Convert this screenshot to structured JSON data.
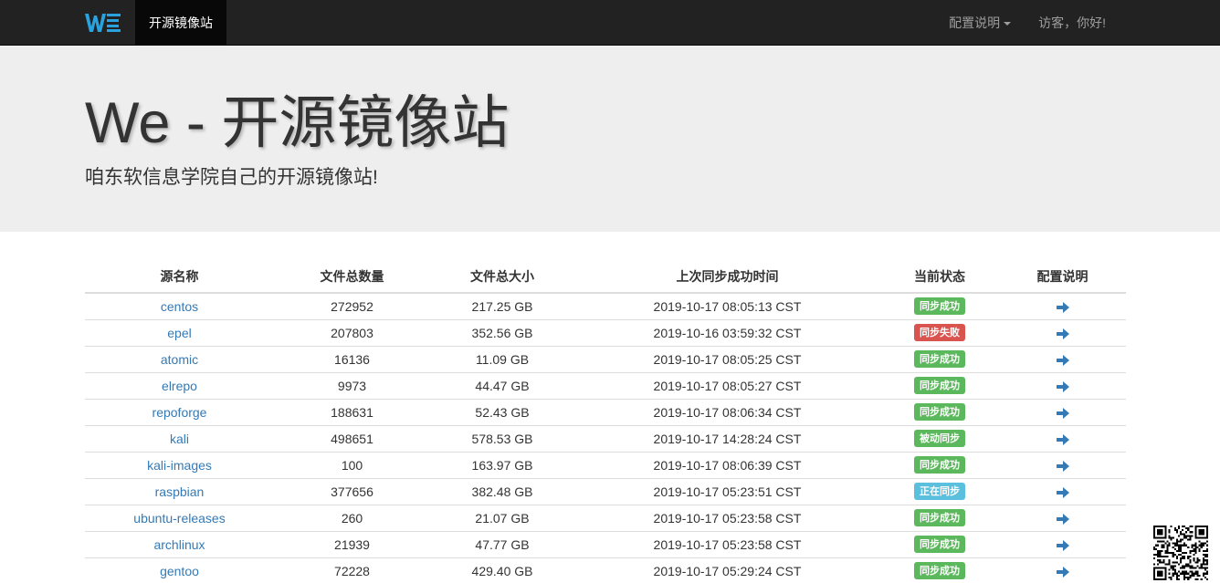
{
  "navbar": {
    "brand_logo": "WE",
    "brand_title": "开源镜像站",
    "config_menu_label": "配置说明",
    "greeting": "访客，你好!"
  },
  "jumbotron": {
    "title": "We - 开源镜像站",
    "subtitle": "咱东软信息学院自己的开源镜像站!"
  },
  "table": {
    "headers": [
      "源名称",
      "文件总数量",
      "文件总大小",
      "上次同步成功时间",
      "当前状态",
      "配置说明"
    ],
    "rows": [
      {
        "name": "centos",
        "files": "272952",
        "size": "217.25 GB",
        "time": "2019-10-17 08:05:13 CST",
        "status": "同步成功",
        "status_color": "#5cb85c"
      },
      {
        "name": "epel",
        "files": "207803",
        "size": "352.56 GB",
        "time": "2019-10-16 03:59:32 CST",
        "status": "同步失败",
        "status_color": "#d9534f"
      },
      {
        "name": "atomic",
        "files": "16136",
        "size": "11.09 GB",
        "time": "2019-10-17 08:05:25 CST",
        "status": "同步成功",
        "status_color": "#5cb85c"
      },
      {
        "name": "elrepo",
        "files": "9973",
        "size": "44.47 GB",
        "time": "2019-10-17 08:05:27 CST",
        "status": "同步成功",
        "status_color": "#5cb85c"
      },
      {
        "name": "repoforge",
        "files": "188631",
        "size": "52.43 GB",
        "time": "2019-10-17 08:06:34 CST",
        "status": "同步成功",
        "status_color": "#5cb85c"
      },
      {
        "name": "kali",
        "files": "498651",
        "size": "578.53 GB",
        "time": "2019-10-17 14:28:24 CST",
        "status": "被动同步",
        "status_color": "#5cb85c"
      },
      {
        "name": "kali-images",
        "files": "100",
        "size": "163.97 GB",
        "time": "2019-10-17 08:06:39 CST",
        "status": "同步成功",
        "status_color": "#5cb85c"
      },
      {
        "name": "raspbian",
        "files": "377656",
        "size": "382.48 GB",
        "time": "2019-10-17 05:23:51 CST",
        "status": "正在同步",
        "status_color": "#5bc0de"
      },
      {
        "name": "ubuntu-releases",
        "files": "260",
        "size": "21.07 GB",
        "time": "2019-10-17 05:23:58 CST",
        "status": "同步成功",
        "status_color": "#5cb85c"
      },
      {
        "name": "archlinux",
        "files": "21939",
        "size": "47.77 GB",
        "time": "2019-10-17 05:23:58 CST",
        "status": "同步成功",
        "status_color": "#5cb85c"
      },
      {
        "name": "gentoo",
        "files": "72228",
        "size": "429.40 GB",
        "time": "2019-10-17 05:29:24 CST",
        "status": "同步成功",
        "status_color": "#5cb85c"
      }
    ]
  },
  "icons": {
    "config_link_icon": "arrow-right-icon",
    "qr_code": "qr-code-image"
  },
  "colors": {
    "navbar_bg": "#222222",
    "jumbotron_bg": "#eeeeee",
    "link": "#337ab7",
    "logo_blue": "#29a3e0"
  }
}
